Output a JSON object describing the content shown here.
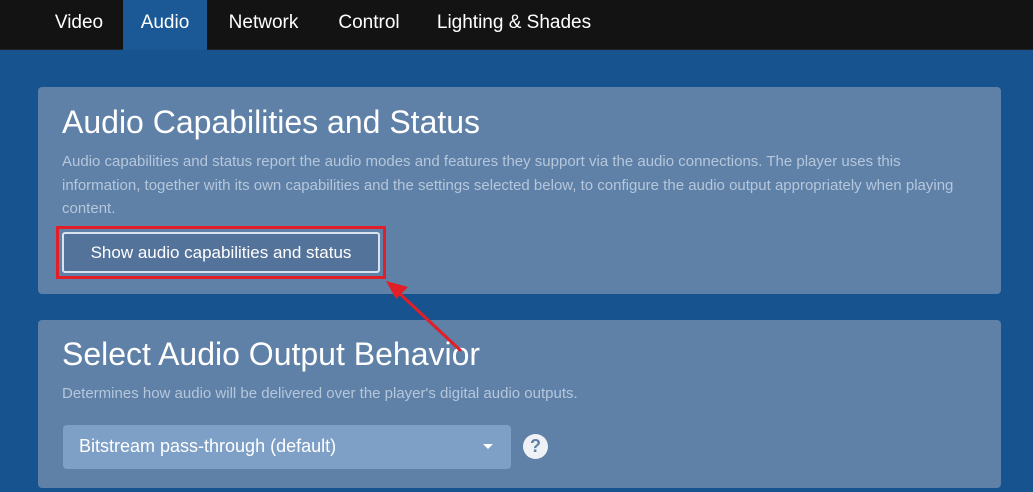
{
  "nav": {
    "tabs": [
      {
        "label": "Video"
      },
      {
        "label": "Audio"
      },
      {
        "label": "Network"
      },
      {
        "label": "Control"
      },
      {
        "label": "Lighting & Shades"
      }
    ],
    "active_tab": "Audio"
  },
  "capabilities": {
    "title": "Audio Capabilities and Status",
    "description": "Audio capabilities and status report the audio modes and features they support via the audio connections. The player uses this information, together with its own capabilities and the settings selected below, to configure the audio output appropriately when playing content.",
    "button_label": "Show audio capabilities and status"
  },
  "output": {
    "title": "Select Audio Output Behavior",
    "description": "Determines how audio will be delivered over the player's digital audio outputs.",
    "selected_value": "Bitstream pass-through (default)",
    "help_icon": "?"
  },
  "colors": {
    "background": "#16538f",
    "nav_background": "#131313",
    "active_tab": "#1a5896",
    "panel": "#5f80a7",
    "highlight": "#e21e26"
  },
  "icons": {
    "dropdown": "caret-down-icon",
    "help": "question-circle-icon",
    "annotation": "red-arrow-icon"
  }
}
